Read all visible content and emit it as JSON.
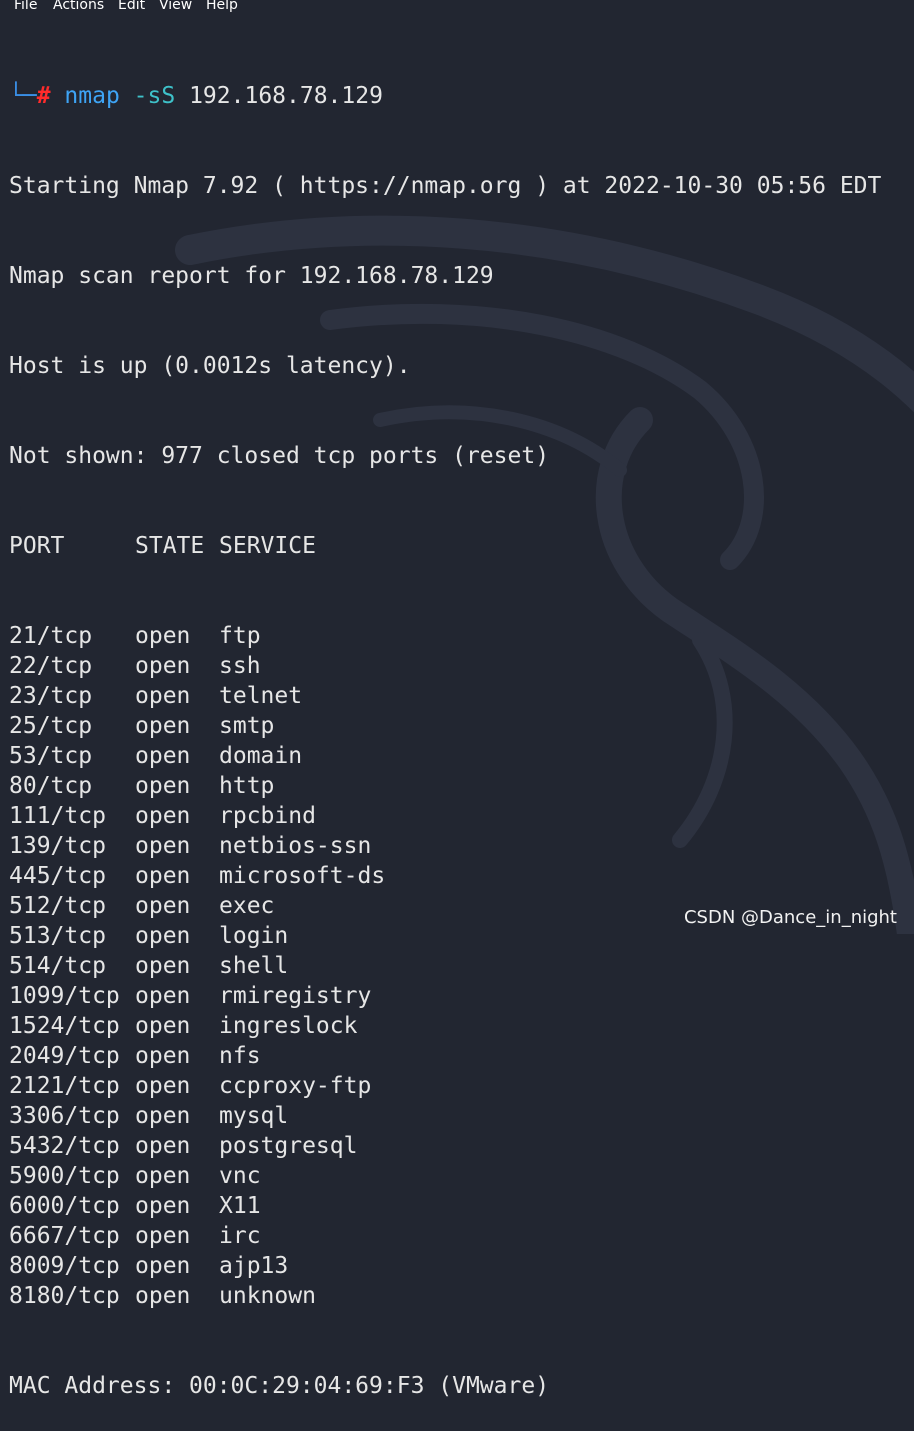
{
  "menu": {
    "items": [
      "File",
      "Actions",
      "Edit",
      "View",
      "Help"
    ]
  },
  "prompt": {
    "corner": "└─",
    "symbol": "#",
    "command": "nmap",
    "flag": "-sS",
    "target": "192.168.78.129"
  },
  "output": {
    "starting": "Starting Nmap 7.92 ( https://nmap.org ) at 2022-10-30 05:56 EDT",
    "report": "Nmap scan report for 192.168.78.129",
    "host_up": "Host is up (0.0012s latency).",
    "not_shown": "Not shown: 977 closed tcp ports (reset)",
    "header": {
      "port": "PORT",
      "state": "STATE",
      "service": "SERVICE"
    },
    "ports": [
      {
        "port": "21/tcp",
        "state": "open",
        "service": "ftp"
      },
      {
        "port": "22/tcp",
        "state": "open",
        "service": "ssh"
      },
      {
        "port": "23/tcp",
        "state": "open",
        "service": "telnet"
      },
      {
        "port": "25/tcp",
        "state": "open",
        "service": "smtp"
      },
      {
        "port": "53/tcp",
        "state": "open",
        "service": "domain"
      },
      {
        "port": "80/tcp",
        "state": "open",
        "service": "http"
      },
      {
        "port": "111/tcp",
        "state": "open",
        "service": "rpcbind"
      },
      {
        "port": "139/tcp",
        "state": "open",
        "service": "netbios-ssn"
      },
      {
        "port": "445/tcp",
        "state": "open",
        "service": "microsoft-ds"
      },
      {
        "port": "512/tcp",
        "state": "open",
        "service": "exec"
      },
      {
        "port": "513/tcp",
        "state": "open",
        "service": "login"
      },
      {
        "port": "514/tcp",
        "state": "open",
        "service": "shell"
      },
      {
        "port": "1099/tcp",
        "state": "open",
        "service": "rmiregistry"
      },
      {
        "port": "1524/tcp",
        "state": "open",
        "service": "ingreslock"
      },
      {
        "port": "2049/tcp",
        "state": "open",
        "service": "nfs"
      },
      {
        "port": "2121/tcp",
        "state": "open",
        "service": "ccproxy-ftp"
      },
      {
        "port": "3306/tcp",
        "state": "open",
        "service": "mysql"
      },
      {
        "port": "5432/tcp",
        "state": "open",
        "service": "postgresql"
      },
      {
        "port": "5900/tcp",
        "state": "open",
        "service": "vnc"
      },
      {
        "port": "6000/tcp",
        "state": "open",
        "service": "X11"
      },
      {
        "port": "6667/tcp",
        "state": "open",
        "service": "irc"
      },
      {
        "port": "8009/tcp",
        "state": "open",
        "service": "ajp13"
      },
      {
        "port": "8180/tcp",
        "state": "open",
        "service": "unknown"
      }
    ],
    "mac": "MAC Address: 00:0C:29:04:69:F3 (VMware)"
  },
  "watermark": "CSDN @Dance_in_night",
  "colors": {
    "background": "#222631",
    "text": "#e6e6e6",
    "prompt_corner": "#3a8fe6",
    "prompt_hash": "#ff2b2b",
    "command": "#3ea4f5",
    "flag": "#3ec1c9"
  }
}
